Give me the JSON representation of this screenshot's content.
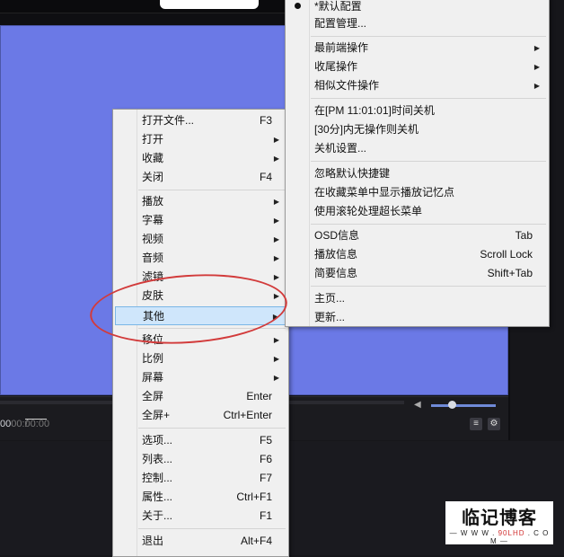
{
  "player": {
    "time_current": "00",
    "time_sep": " / ",
    "time_total": "00:00:00"
  },
  "context_menu": {
    "items": [
      {
        "label": "打开文件...",
        "shortcut": "F3"
      },
      {
        "label": "打开",
        "submenu": true
      },
      {
        "label": "收藏",
        "submenu": true
      },
      {
        "label": "关闭",
        "shortcut": "F4"
      },
      {
        "label": "播放",
        "submenu": true
      },
      {
        "label": "字幕",
        "submenu": true
      },
      {
        "label": "视频",
        "submenu": true
      },
      {
        "label": "音频",
        "submenu": true
      },
      {
        "label": "滤镜",
        "submenu": true
      },
      {
        "label": "皮肤",
        "submenu": true
      },
      {
        "label": "其他",
        "submenu": true,
        "highlighted": true
      },
      {
        "label": "移位",
        "submenu": true
      },
      {
        "label": "比例",
        "submenu": true
      },
      {
        "label": "屏幕",
        "submenu": true
      },
      {
        "label": "全屏",
        "shortcut": "Enter"
      },
      {
        "label": "全屏+",
        "shortcut": "Ctrl+Enter"
      },
      {
        "label": "选项...",
        "shortcut": "F5"
      },
      {
        "label": "列表...",
        "shortcut": "F6"
      },
      {
        "label": "控制...",
        "shortcut": "F7"
      },
      {
        "label": "属性...",
        "shortcut": "Ctrl+F1"
      },
      {
        "label": "关于...",
        "shortcut": "F1"
      },
      {
        "label": "退出",
        "shortcut": "Alt+F4"
      }
    ]
  },
  "submenu": {
    "items": [
      {
        "label": "*默认配置",
        "checked": true
      },
      {
        "label": "配置管理..."
      },
      {
        "label": "最前端操作",
        "submenu": true
      },
      {
        "label": "收尾操作",
        "submenu": true
      },
      {
        "label": "相似文件操作",
        "submenu": true
      },
      {
        "label": "在[PM 11:01:01]时间关机"
      },
      {
        "label": "[30分]内无操作则关机"
      },
      {
        "label": "关机设置..."
      },
      {
        "label": "忽略默认快捷键"
      },
      {
        "label": "在收藏菜单中显示播放记忆点"
      },
      {
        "label": "使用滚轮处理超长菜单"
      },
      {
        "label": "OSD信息",
        "shortcut": "Tab"
      },
      {
        "label": "播放信息",
        "shortcut": "Scroll Lock"
      },
      {
        "label": "简要信息",
        "shortcut": "Shift+Tab"
      },
      {
        "label": "主页..."
      },
      {
        "label": "更新..."
      }
    ]
  },
  "watermark": {
    "title": "临记博客",
    "sub_prefix": "— W W W . ",
    "sub_brand": "90LHD",
    "sub_suffix": " . C O M —"
  },
  "colors": {
    "video_bg": "#6b79e6",
    "menu_bg": "#f0f0f0",
    "highlight_bg": "#cfe6fb",
    "annotation": "#d23b3b"
  }
}
